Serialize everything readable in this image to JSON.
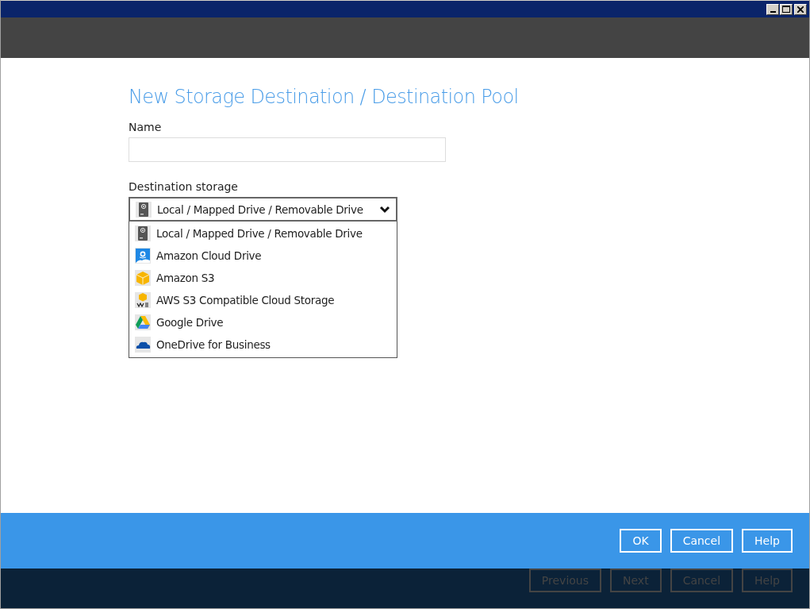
{
  "dialog": {
    "title": "New Storage Destination / Destination Pool"
  },
  "name_field": {
    "label": "Name"
  },
  "destination": {
    "label": "Destination storage",
    "expanded": true,
    "value": {
      "label": "Local / Mapped Drive / Removable Drive",
      "kind": "drive"
    },
    "options": [
      {
        "label": "Local / Mapped Drive / Removable Drive",
        "kind": "drive"
      },
      {
        "label": "Amazon Cloud Drive",
        "kind": "amazon-cloud"
      },
      {
        "label": "Amazon S3",
        "kind": "s3"
      },
      {
        "label": "AWS S3 Compatible Cloud Storage",
        "kind": "aws"
      },
      {
        "label": "Google Drive",
        "kind": "gdrive"
      },
      {
        "label": "OneDrive for Business",
        "kind": "onedrive"
      }
    ]
  },
  "dialog_buttons": [
    {
      "label": "OK",
      "disabled": false
    },
    {
      "label": "Cancel",
      "disabled": false
    },
    {
      "label": "Help",
      "disabled": false
    }
  ],
  "wizard_buttons": [
    {
      "label": "Previous",
      "disabled": true
    },
    {
      "label": "Next",
      "disabled": true
    },
    {
      "label": "Cancel",
      "disabled": true
    },
    {
      "label": "Help",
      "disabled": true
    }
  ]
}
